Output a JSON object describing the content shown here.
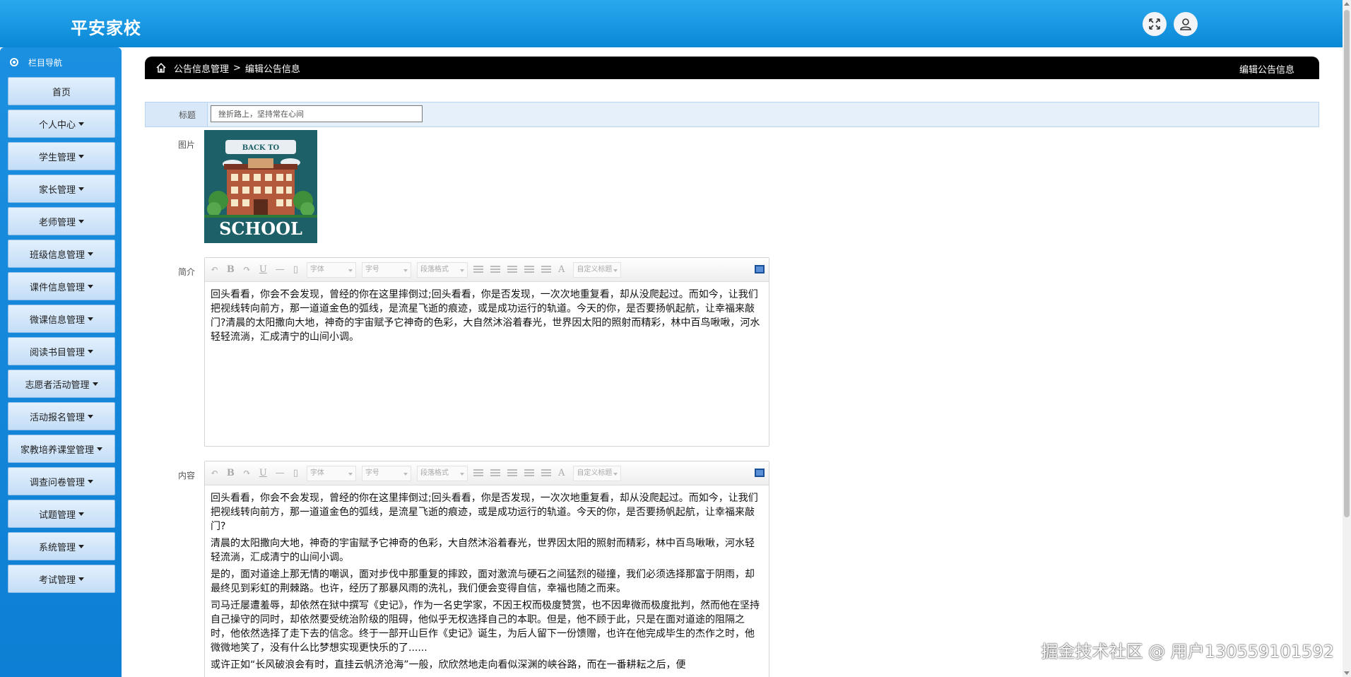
{
  "header": {
    "app_title": "平安家校",
    "fullscreen_icon": "expand-arrows-icon",
    "user_icon": "user-icon"
  },
  "sidebar": {
    "heading": "栏目导航",
    "items": [
      {
        "label": "首页",
        "has_caret": false
      },
      {
        "label": "个人中心",
        "has_caret": true
      },
      {
        "label": "学生管理",
        "has_caret": true
      },
      {
        "label": "家长管理",
        "has_caret": true
      },
      {
        "label": "老师管理",
        "has_caret": true
      },
      {
        "label": "班级信息管理",
        "has_caret": true
      },
      {
        "label": "课件信息管理",
        "has_caret": true
      },
      {
        "label": "微课信息管理",
        "has_caret": true
      },
      {
        "label": "阅读书目管理",
        "has_caret": true
      },
      {
        "label": "志愿者活动管理",
        "has_caret": true
      },
      {
        "label": "活动报名管理",
        "has_caret": true
      },
      {
        "label": "家教培养课堂管理",
        "has_caret": true
      },
      {
        "label": "调查问卷管理",
        "has_caret": true
      },
      {
        "label": "试题管理",
        "has_caret": true
      },
      {
        "label": "系统管理",
        "has_caret": true
      },
      {
        "label": "考试管理",
        "has_caret": true
      }
    ]
  },
  "breadcrumb": {
    "parent": "公告信息管理",
    "separator": ">",
    "current": "编辑公告信息",
    "right_title": "编辑公告信息"
  },
  "form": {
    "title_label": "标题",
    "title_value": "挫折路上，坚持常在心间",
    "picture_label": "图片",
    "picture_text_top": "BACK TO",
    "picture_text_bottom": "SCHOOL",
    "summary_label": "简介",
    "content_label": "内容"
  },
  "toolbar": {
    "font_label": "字体",
    "size_label": "字号",
    "paragraph_label": "段落格式",
    "custom_title_label": "自定义标题",
    "bold": "B",
    "italic": "I",
    "underline": "U",
    "color": "A"
  },
  "summary_text": "回头看看，你会不会发现，曾经的你在这里摔倒过;回头看看，你是否发现，一次次地重复看，却从没爬起过。而如今，让我们把视线转向前方，那一道道金色的弧线，是流星飞逝的痕迹，或是成功运行的轨道。今天的你，是否要扬帆起航，让幸福来敲门?清晨的太阳撒向大地，神奇的宇宙赋予它神奇的色彩，大自然沐浴着春光，世界因太阳的照射而精彩，林中百鸟啾啾，河水轻轻流淌，汇成清宁的山间小调。",
  "content_paragraphs": [
    "回头看看，你会不会发现，曾经的你在这里摔倒过;回头看看，你是否发现，一次次地重复看，却从没爬起过。而如今，让我们把视线转向前方，那一道道金色的弧线，是流星飞逝的痕迹，或是成功运行的轨道。今天的你，是否要扬帆起航，让幸福来敲门?",
    "清晨的太阳撒向大地，神奇的宇宙赋予它神奇的色彩，大自然沐浴着春光，世界因太阳的照射而精彩，林中百鸟啾啾，河水轻轻流淌，汇成清宁的山间小调。",
    "是的，面对道途上那无情的嘲讽，面对步伐中那重复的摔跤，面对激流与硬石之间猛烈的碰撞，我们必须选择那富于阴雨，却最终见到彩虹的荆棘路。也许，经历了那暴风雨的洗礼，我们便会变得自信，幸福也随之而来。",
    "司马迁屡遭羞辱，却依然在狱中撰写《史记》，作为一名史学家，不因王权而极度赞赏，也不因卑微而极度批判，然而他在坚持自己操守的同时，却依然要受统治阶级的阻碍，他似乎无权选择自己的本职。但是，他不顾于此，只是在面对道途的阻隔之时，他依然选择了走下去的信念。终于一部开山巨作《史记》诞生，为后人留下一份馈赠，也许在他完成毕生的杰作之时，他微微地笑了，没有什么比梦想实现更快乐的了......",
    "或许正如“长风破浪会有时，直挂云帆济沧海”一般，欣欣然地走向看似深渊的峡谷路，而在一番耕耘之后，便"
  ],
  "watermark": "掘金技术社区 @ 用户130559101592"
}
